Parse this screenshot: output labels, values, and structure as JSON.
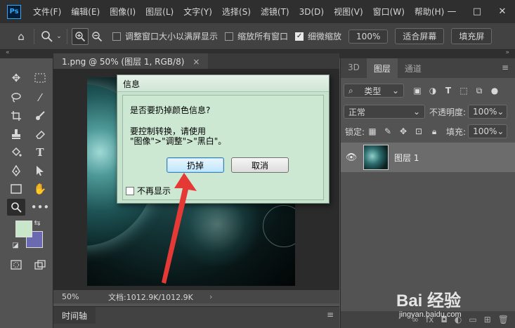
{
  "app": {
    "logo": "Ps",
    "menu": [
      "文件(F)",
      "编辑(E)",
      "图像(I)",
      "图层(L)",
      "文字(Y)",
      "选择(S)",
      "滤镜(T)",
      "3D(D)",
      "视图(V)",
      "窗口(W)",
      "帮助(H)"
    ],
    "window_controls": [
      "—",
      "□",
      "✕"
    ]
  },
  "options_bar": {
    "resize_window_label": "调整窗口大小以满屏显示",
    "resize_window_checked": false,
    "zoom_all_label": "缩放所有窗口",
    "zoom_all_checked": false,
    "scrubby_zoom_label": "细微缩放",
    "scrubby_zoom_checked": true,
    "zoom_100_label": "100%",
    "fit_screen_label": "适合屏幕",
    "fill_screen_label": "填充屏"
  },
  "document": {
    "tab_title": "1.png @ 50% (图层 1, RGB/8)",
    "tab_close": "×",
    "status_zoom": "50%",
    "status_doc": "文档:1012.9K/1012.9K",
    "status_arrow": "›"
  },
  "timeline": {
    "tab": "时间轴"
  },
  "panel": {
    "tabs": [
      "3D",
      "图层",
      "通道"
    ],
    "active_tab": "图层",
    "filter_kind": "类型",
    "blend_mode": "正常",
    "opacity_label": "不透明度:",
    "opacity_value": "100%",
    "lock_label": "锁定:",
    "fill_label": "填充:",
    "fill_value": "100%",
    "layers": [
      {
        "name": "图层 1",
        "visible": true
      }
    ]
  },
  "dialog": {
    "title": "信息",
    "question": "是否要扔掉颜色信息?",
    "instruction_line1": "要控制转换，请使用",
    "instruction_line2": "\"图像\">\"调整\">\"黑白\"。",
    "discard_button": "扔掉",
    "cancel_button": "取消",
    "dont_show_label": "不再显示"
  },
  "colors": {
    "foreground": "#c8e6c9",
    "background": "#6b69b0",
    "annotation_arrow": "#e53935"
  },
  "watermark": {
    "logo": "Bai 经验",
    "url": "jingyan.baidu.com"
  }
}
